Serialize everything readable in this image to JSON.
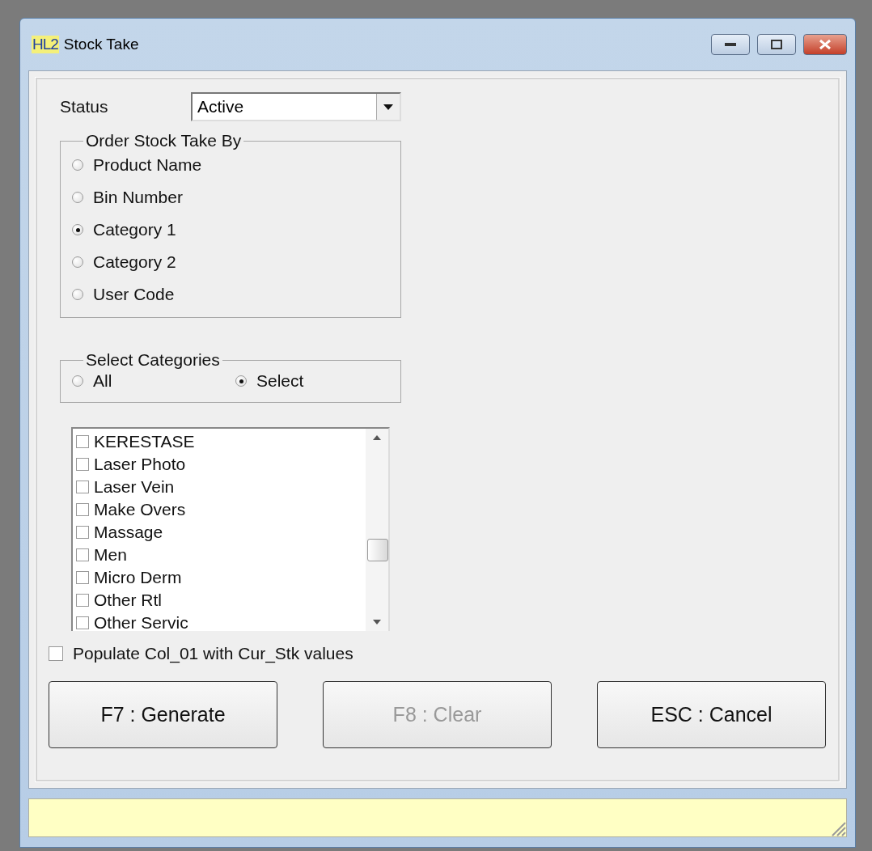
{
  "window": {
    "title": "Stock Take",
    "icon_text": "HL2"
  },
  "status": {
    "label": "Status",
    "value": "Active"
  },
  "order_by": {
    "title": "Order Stock Take By",
    "options": [
      {
        "label": "Product Name",
        "selected": false
      },
      {
        "label": "Bin Number",
        "selected": false
      },
      {
        "label": "Category 1",
        "selected": true
      },
      {
        "label": "Category 2",
        "selected": false
      },
      {
        "label": "User Code",
        "selected": false
      }
    ]
  },
  "select_categories": {
    "title": "Select Categories",
    "options": [
      {
        "label": "All",
        "selected": false
      },
      {
        "label": "Select",
        "selected": true
      }
    ]
  },
  "categories": [
    {
      "label": "KERESTASE",
      "checked": false
    },
    {
      "label": "Laser Photo",
      "checked": false
    },
    {
      "label": "Laser Vein",
      "checked": false
    },
    {
      "label": "Make Overs",
      "checked": false
    },
    {
      "label": "Massage",
      "checked": false
    },
    {
      "label": "Men",
      "checked": false
    },
    {
      "label": "Micro Derm",
      "checked": false
    },
    {
      "label": "Other Rtl",
      "checked": false
    },
    {
      "label": "Other Servic",
      "checked": false
    }
  ],
  "populate": {
    "label": "Populate Col_01 with Cur_Stk values",
    "checked": false
  },
  "buttons": [
    {
      "label": "F7 : Generate",
      "disabled": false
    },
    {
      "label": "F8 : Clear",
      "disabled": true
    },
    {
      "label": "ESC : Cancel",
      "disabled": false
    }
  ]
}
